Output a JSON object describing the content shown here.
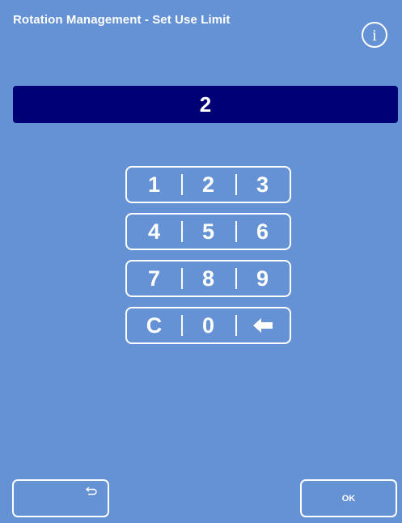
{
  "header": {
    "title": "Rotation Management - Set Use Limit",
    "info_icon": "info-circle-icon"
  },
  "display": {
    "value": "2"
  },
  "keypad": {
    "rows": [
      [
        "1",
        "2",
        "3"
      ],
      [
        "4",
        "5",
        "6"
      ],
      [
        "7",
        "8",
        "9"
      ],
      [
        "C",
        "0",
        ""
      ]
    ],
    "backspace_icon": "backspace-arrow-icon"
  },
  "footer": {
    "back_icon": "return-arrow-icon",
    "ok_label": "OK"
  },
  "colors": {
    "background": "#6592d4",
    "display_background": "#000075",
    "foreground": "#ffffff"
  }
}
